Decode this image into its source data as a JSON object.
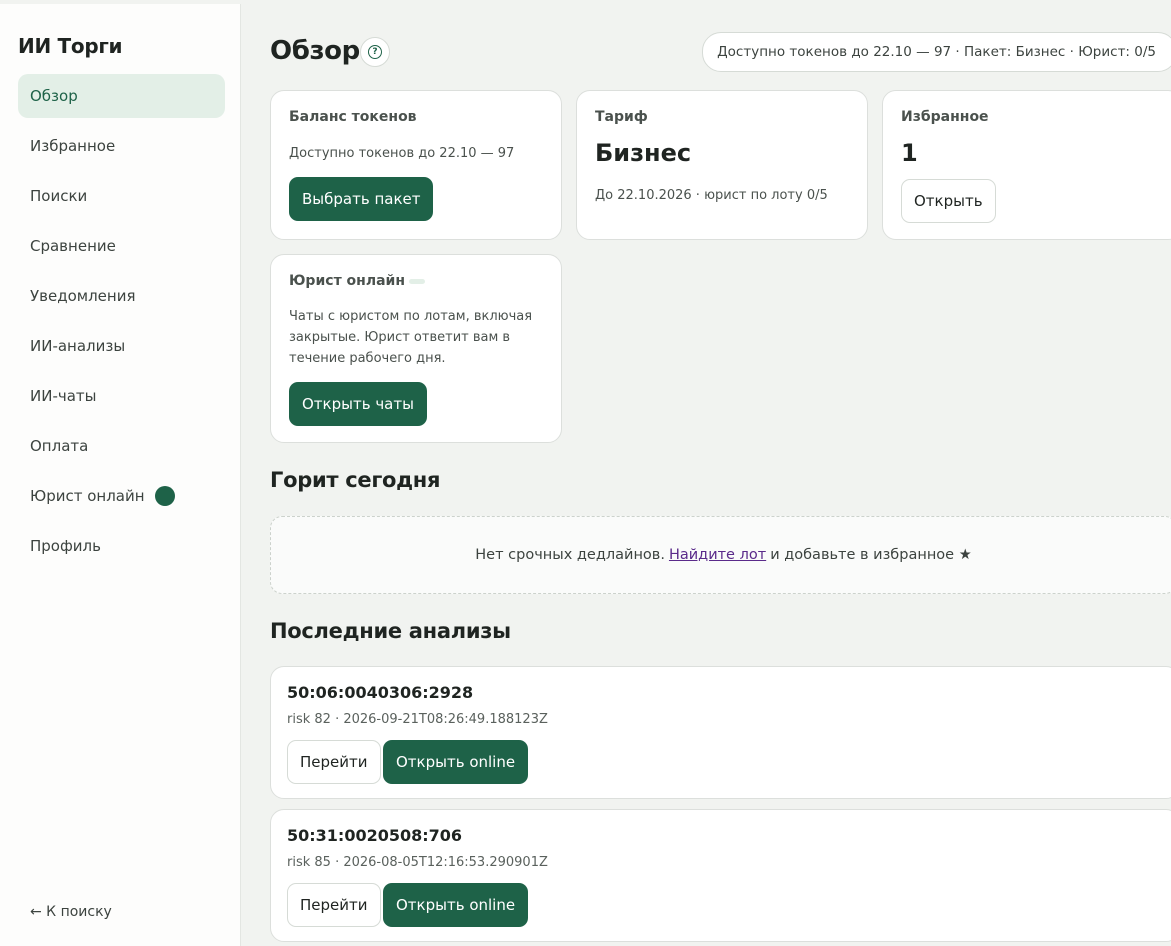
{
  "sidebar": {
    "brand": "ИИ Торги",
    "items": [
      {
        "label": "Обзор"
      },
      {
        "label": "Избранное"
      },
      {
        "label": "Поиски"
      },
      {
        "label": "Сравнение"
      },
      {
        "label": "Уведомления"
      },
      {
        "label": "ИИ-анализы"
      },
      {
        "label": "ИИ-чаты"
      },
      {
        "label": "Оплата"
      },
      {
        "label": "Юрист онлайн"
      },
      {
        "label": "Профиль"
      }
    ],
    "back_link": "← К поиску"
  },
  "header": {
    "title": "Обзор",
    "help_icon": "?",
    "token_pill": "Доступно токенов до 22.10 — 97 · Пакет: Бизнес · Юрист: 0/5"
  },
  "cards": {
    "balance": {
      "label": "Баланс токенов",
      "text": "Доступно токенов до 22.10 — 97",
      "button": "Выбрать пакет"
    },
    "tariff": {
      "label": "Тариф",
      "value": "Бизнес",
      "text": "До 22.10.2026 · юрист по лоту 0/5"
    },
    "favorites": {
      "label": "Избранное",
      "value": "1",
      "button": "Открыть"
    },
    "lawyer": {
      "label": "Юрист онлайн",
      "text_lines": [
        "Чаты с юристом по лотам, включая",
        "закрытые. Юрист ответит вам в",
        "течение рабочего дня."
      ],
      "button": "Открыть чаты"
    }
  },
  "hot_today": {
    "title": "Горит сегодня",
    "empty_before": "Нет срочных дедлайнов.",
    "empty_link": "Найдите лот",
    "empty_after": "и добавьте в избранное ★"
  },
  "analyses": {
    "title": "Последние анализы",
    "items": [
      {
        "id": "50:06:0040306:2928",
        "meta": "risk 82 · 2026-09-21T08:26:49.188123Z",
        "go_button": "Перейти",
        "online_button": "Открыть online"
      },
      {
        "id": "50:31:0020508:706",
        "meta": "risk 85 · 2026-08-05T12:16:53.290901Z",
        "go_button": "Перейти",
        "online_button": "Открыть online"
      }
    ]
  },
  "colors": {
    "accent": "#1e6248",
    "active_nav_bg": "#e3efe7",
    "page_bg": "#f1f3f0"
  }
}
